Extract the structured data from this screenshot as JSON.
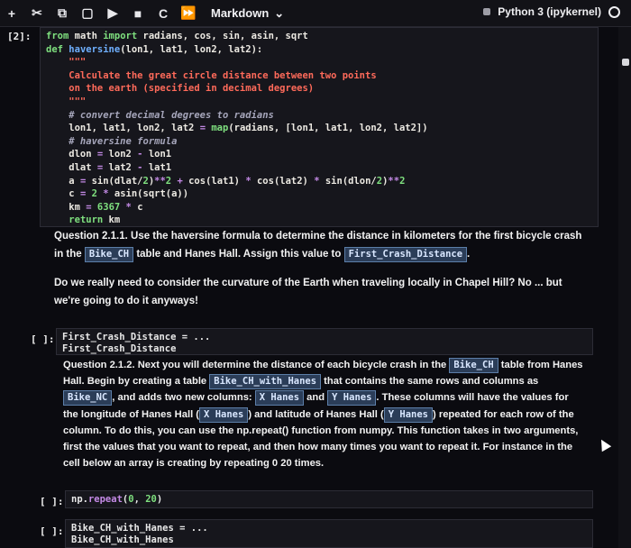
{
  "toolbar": {
    "buttons": [
      {
        "name": "add-cell-button",
        "glyph": "+"
      },
      {
        "name": "cut-button",
        "glyph": "✂"
      },
      {
        "name": "copy-button",
        "glyph": "⧉"
      },
      {
        "name": "paste-button",
        "glyph": "▢"
      },
      {
        "name": "run-button",
        "glyph": "▶"
      },
      {
        "name": "stop-button",
        "glyph": "■"
      },
      {
        "name": "restart-button",
        "glyph": "C"
      },
      {
        "name": "fast-forward-button",
        "glyph": "⏩"
      }
    ],
    "cell_type": "Markdown",
    "cell_type_chevron": "⌄",
    "kernel": "Python 3 (ipykernel)"
  },
  "cells": {
    "code1": {
      "prompt": "[2]:",
      "lines": [
        "from math import radians, cos, sin, asin, sqrt",
        "def haversine(lon1, lat1, lon2, lat2):",
        "    \"\"\"",
        "    Calculate the great circle distance between two points",
        "    on the earth (specified in decimal degrees)",
        "    \"\"\"",
        "    # convert decimal degrees to radians",
        "    lon1, lat1, lon2, lat2 = map(radians, [lon1, lat1, lon2, lat2])",
        "    # haversine formula",
        "    dlon = lon2 - lon1",
        "    dlat = lat2 - lat1",
        "    a = sin(dlat/2)**2 + cos(lat1) * cos(lat2) * sin(dlon/2)**2",
        "    c = 2 * asin(sqrt(a))",
        "    km = 6367 * c",
        "    return km"
      ]
    },
    "md1": {
      "q_label": "Question 2.1.1.",
      "text_a": " Use the haversine formula to determine the distance in kilometers for the first bicycle crash in the ",
      "tag1": "Bike_CH",
      "text_b": " table and Hanes Hall. Assign this value to ",
      "tag2": "First_Crash_Distance",
      "text_c": ".",
      "para2": "Do we really need to consider the curvature of the Earth when traveling locally in Chapel Hill? No ... but we're going to do it anyways!"
    },
    "in2": {
      "prompt": "[ ]:",
      "line1": "First_Crash_Distance = ...",
      "line2": "First_Crash_Distance"
    },
    "md2": {
      "q_label": "Question 2.1.2.",
      "t1": " Next you will determine the distance of each bicycle crash in the ",
      "tag_a": "Bike_CH",
      "t2": " table from Hanes Hall. Begin by creating a table ",
      "tag_b": "Bike_CH_with_Hanes",
      "t3": " that contains the same rows and columns as ",
      "tag_c": "Bike_NC",
      "t4": ", and adds two new columns: ",
      "tag_d": "X Hanes",
      "t5": " and ",
      "tag_e": "Y Hanes",
      "t6": ". These columns will have the values for the longitude of Hanes Hall (",
      "tag_f": "X Hanes",
      "t7": ") and latitude of Hanes Hall (",
      "tag_g": "Y Hanes",
      "t8": ") repeated for each row of the column. To do this, you can use the np.repeat() function from numpy. This function takes in two arguments, first the values that you want to repeat, and then how many times you want to repeat it. For instance in the cell below an array is creating by repeating 0 20 times."
    },
    "in3": {
      "prompt": "[ ]:",
      "code": "np.repeat(0, 20)"
    },
    "in4": {
      "prompt": "[ ]:",
      "line1": "Bike_CH_with_Hanes = ...",
      "line2": "Bike_CH_with_Hanes"
    }
  }
}
